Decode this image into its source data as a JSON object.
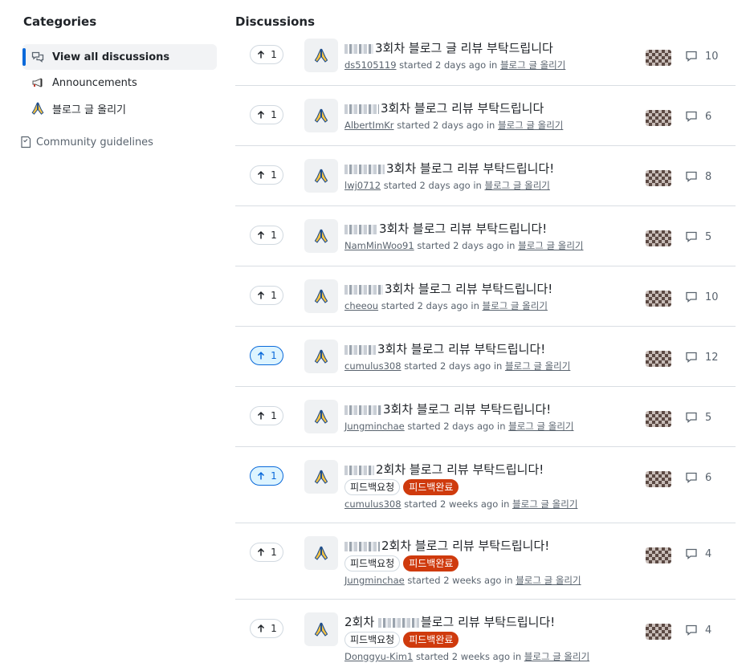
{
  "sidebar": {
    "title": "Categories",
    "items": [
      {
        "label": "View all discussions",
        "icon": "discussions-icon",
        "active": true
      },
      {
        "label": "Announcements",
        "icon": "megaphone-icon",
        "active": false
      },
      {
        "label": "블로그 글 올리기",
        "icon": "folded-hands-emoji-icon",
        "active": false
      }
    ],
    "guidelines": {
      "label": "Community guidelines",
      "icon": "guidelines-icon"
    }
  },
  "main": {
    "title": "Discussions",
    "started_text": "started",
    "in_text": "in",
    "discussions": [
      {
        "votes": "1",
        "upvoted": false,
        "title": "3회차 블로그 글 리뷰 부탁드립니다",
        "author": "ds5105119",
        "time": "2 days ago",
        "category": "블로그 글 올리기",
        "comments": "10",
        "labels": []
      },
      {
        "votes": "1",
        "upvoted": false,
        "title": "3회차 블로그 리뷰 부탁드립니다",
        "author": "AlbertImKr",
        "time": "2 days ago",
        "category": "블로그 글 올리기",
        "comments": "6",
        "labels": []
      },
      {
        "votes": "1",
        "upvoted": false,
        "title": "3회차 블로그 리뷰 부탁드립니다!",
        "author": "lwj0712",
        "time": "2 days ago",
        "category": "블로그 글 올리기",
        "comments": "8",
        "labels": []
      },
      {
        "votes": "1",
        "upvoted": false,
        "title": "3회차 블로그 리뷰 부탁드립니다!",
        "author": "NamMinWoo91",
        "time": "2 days ago",
        "category": "블로그 글 올리기",
        "comments": "5",
        "labels": []
      },
      {
        "votes": "1",
        "upvoted": false,
        "title": "3회차 블로그 리뷰 부탁드립니다!",
        "author": "cheeou",
        "time": "2 days ago",
        "category": "블로그 글 올리기",
        "comments": "10",
        "labels": []
      },
      {
        "votes": "1",
        "upvoted": true,
        "title": "3회차 블로그 리뷰 부탁드립니다!",
        "author": "cumulus308",
        "time": "2 days ago",
        "category": "블로그 글 올리기",
        "comments": "12",
        "labels": []
      },
      {
        "votes": "1",
        "upvoted": false,
        "title": "3회차 블로그 리뷰 부탁드립니다!",
        "author": "Jungminchae",
        "time": "2 days ago",
        "category": "블로그 글 올리기",
        "comments": "5",
        "labels": []
      },
      {
        "votes": "1",
        "upvoted": true,
        "title": "2회차 블로그 리뷰 부탁드립니다!",
        "author": "cumulus308",
        "time": "2 weeks ago",
        "category": "블로그 글 올리기",
        "comments": "6",
        "labels": [
          {
            "text": "피드백요청",
            "style": "outline"
          },
          {
            "text": "피드백완료",
            "style": "filled"
          }
        ]
      },
      {
        "votes": "1",
        "upvoted": false,
        "title": "2회차 블로그 리뷰 부탁드립니다!",
        "author": "Jungminchae",
        "time": "2 weeks ago",
        "category": "블로그 글 올리기",
        "comments": "4",
        "labels": [
          {
            "text": "피드백요청",
            "style": "outline"
          },
          {
            "text": "피드백완료",
            "style": "filled"
          }
        ]
      },
      {
        "votes": "1",
        "upvoted": false,
        "title_prefix": "2회차",
        "title": "블로그 리뷰 부탁드립니다!",
        "author": "Donggyu-Kim1",
        "time": "2 weeks ago",
        "category": "블로그 글 올리기",
        "comments": "4",
        "labels": [
          {
            "text": "피드백요청",
            "style": "outline"
          },
          {
            "text": "피드백완료",
            "style": "filled"
          }
        ]
      }
    ]
  },
  "colors": {
    "accent": "#0969da",
    "label_filled": "#cf3a0d",
    "muted": "#59636e"
  }
}
